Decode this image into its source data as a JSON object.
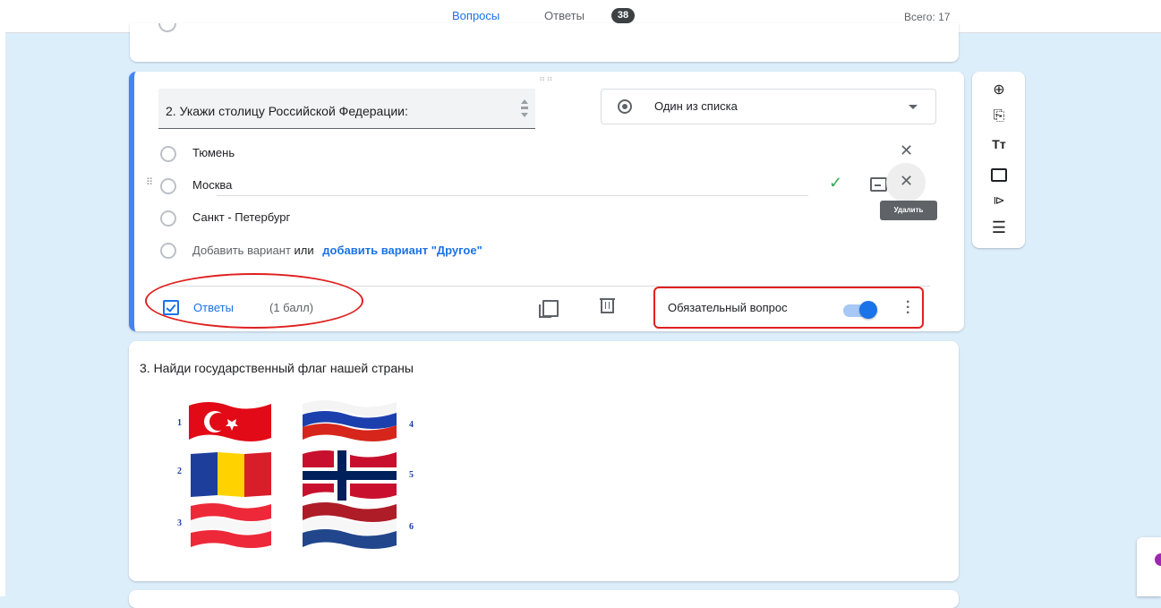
{
  "tabs": {
    "questions": "Вопросы",
    "answers": "Ответы",
    "answers_count": "38",
    "total": "Всего: 17"
  },
  "question2": {
    "title": "2. Укажи столицу Российской Федерации:",
    "type_label": "Один из списка",
    "options": [
      "Тюмень",
      "Москва",
      "Санкт - Петербург"
    ],
    "add_option": "Добавить вариант",
    "or_text": "или",
    "add_other": "добавить вариант \"Другое\"",
    "delete_tooltip": "Удалить",
    "answers_label": "Ответы",
    "points": "(1 балл)",
    "required_label": "Обязательный вопрос",
    "required": true
  },
  "question3": {
    "title": "3. Найди государственный флаг нашей страны",
    "flag_numbers": [
      "1",
      "2",
      "3",
      "4",
      "5",
      "6"
    ]
  },
  "icons": [
    "add-question-icon",
    "import-questions-icon",
    "add-title-icon",
    "add-image-icon",
    "add-video-icon",
    "add-section-icon"
  ],
  "colors": {
    "accent": "#1a73e8",
    "highlight": "#e02020",
    "background": "#ddeefb"
  }
}
